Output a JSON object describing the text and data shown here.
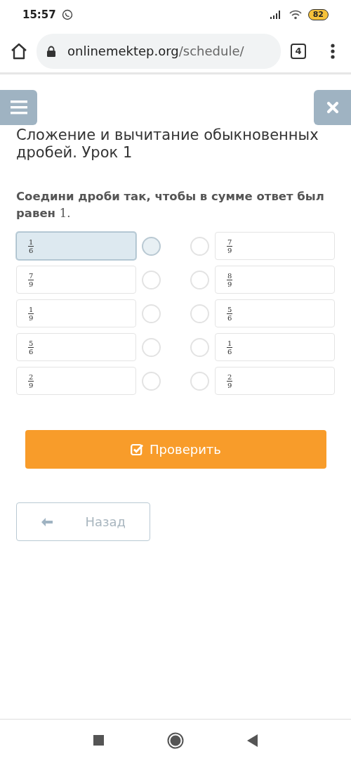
{
  "status_bar": {
    "time": "15:57",
    "battery": "82"
  },
  "browser": {
    "url_domain": "onlinemektep.org",
    "url_path": "/schedule/",
    "tab_count": "4"
  },
  "lesson": {
    "title": "Сложение и вычитание обыкновенных дробей. Урок 1",
    "question": "Соедини дроби так, чтобы в сумме ответ был равен",
    "question_number": "1."
  },
  "left_items": [
    {
      "numerator": "1",
      "denominator": "6",
      "selected": true
    },
    {
      "numerator": "7",
      "denominator": "9",
      "selected": false
    },
    {
      "numerator": "1",
      "denominator": "9",
      "selected": false
    },
    {
      "numerator": "5",
      "denominator": "6",
      "selected": false
    },
    {
      "numerator": "2",
      "denominator": "9",
      "selected": false
    }
  ],
  "right_items": [
    {
      "numerator": "7",
      "denominator": "9",
      "selected": false
    },
    {
      "numerator": "8",
      "denominator": "9",
      "selected": false
    },
    {
      "numerator": "5",
      "denominator": "6",
      "selected": false
    },
    {
      "numerator": "1",
      "denominator": "6",
      "selected": false
    },
    {
      "numerator": "2",
      "denominator": "9",
      "selected": false
    }
  ],
  "buttons": {
    "check": "Проверить",
    "back": "Назад"
  }
}
